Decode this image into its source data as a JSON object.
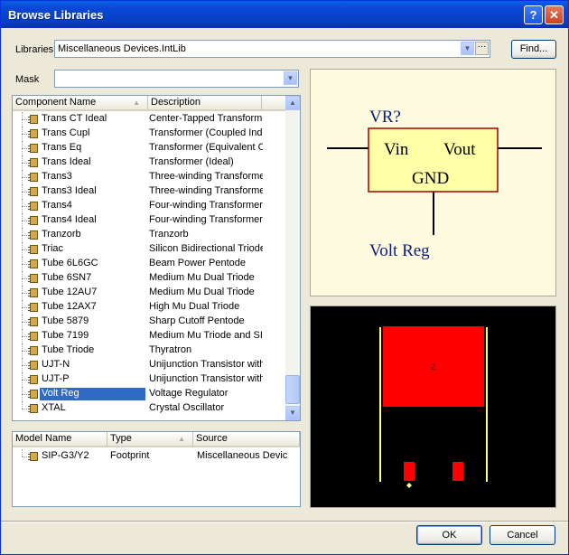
{
  "window": {
    "title": "Browse Libraries"
  },
  "libraries": {
    "label": "Libraries",
    "value": "Miscellaneous Devices.IntLib",
    "find_label": "Find..."
  },
  "mask": {
    "label": "Mask",
    "value": ""
  },
  "component_table": {
    "headers": [
      "Component Name",
      "Description"
    ],
    "rows": [
      {
        "name": "Trans CT Ideal",
        "desc": "Center-Tapped Transforme"
      },
      {
        "name": "Trans Cupl",
        "desc": "Transformer (Coupled Indu"
      },
      {
        "name": "Trans Eq",
        "desc": "Transformer (Equivalent C"
      },
      {
        "name": "Trans Ideal",
        "desc": "Transformer (Ideal)"
      },
      {
        "name": "Trans3",
        "desc": "Three-winding Transforme"
      },
      {
        "name": "Trans3 Ideal",
        "desc": "Three-winding Transforme"
      },
      {
        "name": "Trans4",
        "desc": "Four-winding Transformer"
      },
      {
        "name": "Trans4 Ideal",
        "desc": "Four-winding Transformer"
      },
      {
        "name": "Tranzorb",
        "desc": "Tranzorb"
      },
      {
        "name": "Triac",
        "desc": "Silicon Bidirectional Triode"
      },
      {
        "name": "Tube 6L6GC",
        "desc": "Beam Power Pentode"
      },
      {
        "name": "Tube 6SN7",
        "desc": "Medium Mu Dual Triode"
      },
      {
        "name": "Tube 12AU7",
        "desc": "Medium Mu Dual Triode"
      },
      {
        "name": "Tube 12AX7",
        "desc": "High Mu Dual Triode"
      },
      {
        "name": "Tube 5879",
        "desc": "Sharp Cutoff Pentode"
      },
      {
        "name": "Tube 7199",
        "desc": "Medium Mu Triode and SI"
      },
      {
        "name": "Tube Triode",
        "desc": "Thyratron"
      },
      {
        "name": "UJT-N",
        "desc": "Unijunction Transistor with"
      },
      {
        "name": "UJT-P",
        "desc": "Unijunction Transistor with"
      },
      {
        "name": "Volt Reg",
        "desc": "Voltage Regulator"
      },
      {
        "name": "XTAL",
        "desc": "Crystal Oscillator"
      }
    ],
    "selected_index": 19
  },
  "model_table": {
    "headers": [
      "Model Name",
      "Type",
      "Source"
    ],
    "rows": [
      {
        "name": "SIP-G3/Y2",
        "type": "Footprint",
        "source": "Miscellaneous Devic"
      }
    ]
  },
  "schematic": {
    "designator": "VR?",
    "pin_in": "Vin",
    "pin_out": "Vout",
    "pin_gnd": "GND",
    "comment": "Volt Reg",
    "colors": {
      "background": "#fffbe0",
      "body_fill": "#ffffa8",
      "body_border": "#a00000",
      "text": "#0b1d7a"
    }
  },
  "footprint": {
    "pad_label": "2",
    "colors": {
      "background": "#000000",
      "copper": "#ff0000",
      "silkscreen": "#ffff80"
    }
  },
  "buttons": {
    "ok": "OK",
    "cancel": "Cancel"
  }
}
